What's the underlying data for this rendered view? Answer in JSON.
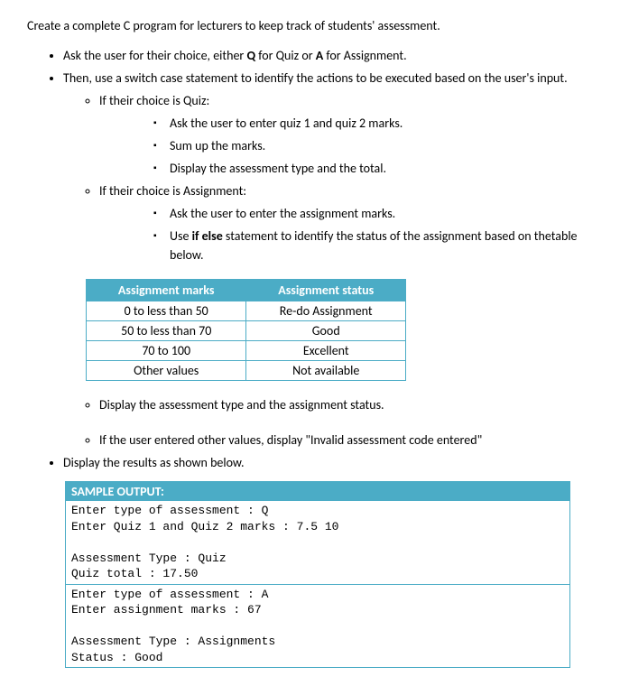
{
  "title": "Create a complete C program for lecturers to keep track of students' assessment.",
  "bullets": {
    "b1_pre": "Ask the user for their choice, either ",
    "b1_q": "Q",
    "b1_mid": " for Quiz or ",
    "b1_a": "A",
    "b1_post": " for Assignment.",
    "b2": "Then, use a switch case statement to identify the actions to be executed based on the user's input.",
    "b2a": "If their choice is Quiz:",
    "b2a1": "Ask the user to enter quiz 1 and quiz 2 marks.",
    "b2a2": "Sum up the marks.",
    "b2a3": "Display the assessment type and the total.",
    "b2b": "If their choice is Assignment:",
    "b2b1": "Ask the user to enter the assignment marks.",
    "b2b2_pre": "Use ",
    "b2b2_bold": "if else",
    "b2b2_post": " statement to identify the status of the assignment based on thetable below.",
    "b2c": "Display the assessment type and the assignment status.",
    "b2d": "If the user entered other values, display \"Invalid assessment code entered\"",
    "b3": "Display the results as shown below."
  },
  "table": {
    "h1": "Assignment marks",
    "h2": "Assignment status",
    "rows": [
      {
        "c1": "0 to less than 50",
        "c2": "Re-do Assignment"
      },
      {
        "c1": "50 to less than 70",
        "c2": "Good"
      },
      {
        "c1": "70 to 100",
        "c2": "Excellent"
      },
      {
        "c1": "Other values",
        "c2": "Not available"
      }
    ]
  },
  "sample": {
    "header": "SAMPLE OUTPUT:",
    "block1": {
      "l1": "Enter type of assessment   : Q",
      "l2": "Enter Quiz 1 and Quiz 2 marks : 7.5 10",
      "l3": "",
      "l4": "Assessment Type : Quiz",
      "l5": "Quiz total : 17.50"
    },
    "block2": {
      "l1": "Enter type of assessment   : A",
      "l2": "Enter assignment marks : 67",
      "l3": "",
      "l4": "Assessment Type : Assignments",
      "l5": "Status : Good"
    }
  }
}
